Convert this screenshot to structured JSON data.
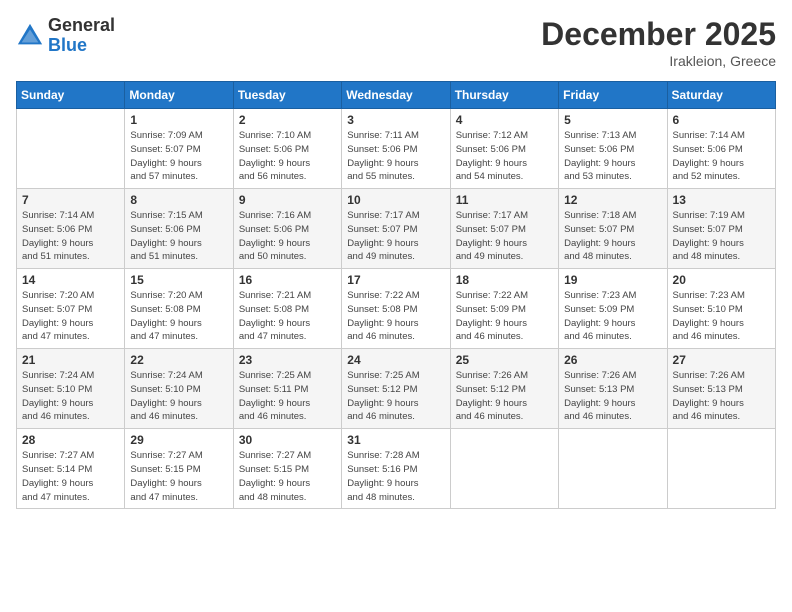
{
  "logo": {
    "general": "General",
    "blue": "Blue"
  },
  "title": "December 2025",
  "location": "Irakleion, Greece",
  "days_of_week": [
    "Sunday",
    "Monday",
    "Tuesday",
    "Wednesday",
    "Thursday",
    "Friday",
    "Saturday"
  ],
  "weeks": [
    [
      {
        "day": "",
        "info": ""
      },
      {
        "day": "1",
        "info": "Sunrise: 7:09 AM\nSunset: 5:07 PM\nDaylight: 9 hours\nand 57 minutes."
      },
      {
        "day": "2",
        "info": "Sunrise: 7:10 AM\nSunset: 5:06 PM\nDaylight: 9 hours\nand 56 minutes."
      },
      {
        "day": "3",
        "info": "Sunrise: 7:11 AM\nSunset: 5:06 PM\nDaylight: 9 hours\nand 55 minutes."
      },
      {
        "day": "4",
        "info": "Sunrise: 7:12 AM\nSunset: 5:06 PM\nDaylight: 9 hours\nand 54 minutes."
      },
      {
        "day": "5",
        "info": "Sunrise: 7:13 AM\nSunset: 5:06 PM\nDaylight: 9 hours\nand 53 minutes."
      },
      {
        "day": "6",
        "info": "Sunrise: 7:14 AM\nSunset: 5:06 PM\nDaylight: 9 hours\nand 52 minutes."
      }
    ],
    [
      {
        "day": "7",
        "info": "Sunrise: 7:14 AM\nSunset: 5:06 PM\nDaylight: 9 hours\nand 51 minutes."
      },
      {
        "day": "8",
        "info": "Sunrise: 7:15 AM\nSunset: 5:06 PM\nDaylight: 9 hours\nand 51 minutes."
      },
      {
        "day": "9",
        "info": "Sunrise: 7:16 AM\nSunset: 5:06 PM\nDaylight: 9 hours\nand 50 minutes."
      },
      {
        "day": "10",
        "info": "Sunrise: 7:17 AM\nSunset: 5:07 PM\nDaylight: 9 hours\nand 49 minutes."
      },
      {
        "day": "11",
        "info": "Sunrise: 7:17 AM\nSunset: 5:07 PM\nDaylight: 9 hours\nand 49 minutes."
      },
      {
        "day": "12",
        "info": "Sunrise: 7:18 AM\nSunset: 5:07 PM\nDaylight: 9 hours\nand 48 minutes."
      },
      {
        "day": "13",
        "info": "Sunrise: 7:19 AM\nSunset: 5:07 PM\nDaylight: 9 hours\nand 48 minutes."
      }
    ],
    [
      {
        "day": "14",
        "info": "Sunrise: 7:20 AM\nSunset: 5:07 PM\nDaylight: 9 hours\nand 47 minutes."
      },
      {
        "day": "15",
        "info": "Sunrise: 7:20 AM\nSunset: 5:08 PM\nDaylight: 9 hours\nand 47 minutes."
      },
      {
        "day": "16",
        "info": "Sunrise: 7:21 AM\nSunset: 5:08 PM\nDaylight: 9 hours\nand 47 minutes."
      },
      {
        "day": "17",
        "info": "Sunrise: 7:22 AM\nSunset: 5:08 PM\nDaylight: 9 hours\nand 46 minutes."
      },
      {
        "day": "18",
        "info": "Sunrise: 7:22 AM\nSunset: 5:09 PM\nDaylight: 9 hours\nand 46 minutes."
      },
      {
        "day": "19",
        "info": "Sunrise: 7:23 AM\nSunset: 5:09 PM\nDaylight: 9 hours\nand 46 minutes."
      },
      {
        "day": "20",
        "info": "Sunrise: 7:23 AM\nSunset: 5:10 PM\nDaylight: 9 hours\nand 46 minutes."
      }
    ],
    [
      {
        "day": "21",
        "info": "Sunrise: 7:24 AM\nSunset: 5:10 PM\nDaylight: 9 hours\nand 46 minutes."
      },
      {
        "day": "22",
        "info": "Sunrise: 7:24 AM\nSunset: 5:10 PM\nDaylight: 9 hours\nand 46 minutes."
      },
      {
        "day": "23",
        "info": "Sunrise: 7:25 AM\nSunset: 5:11 PM\nDaylight: 9 hours\nand 46 minutes."
      },
      {
        "day": "24",
        "info": "Sunrise: 7:25 AM\nSunset: 5:12 PM\nDaylight: 9 hours\nand 46 minutes."
      },
      {
        "day": "25",
        "info": "Sunrise: 7:26 AM\nSunset: 5:12 PM\nDaylight: 9 hours\nand 46 minutes."
      },
      {
        "day": "26",
        "info": "Sunrise: 7:26 AM\nSunset: 5:13 PM\nDaylight: 9 hours\nand 46 minutes."
      },
      {
        "day": "27",
        "info": "Sunrise: 7:26 AM\nSunset: 5:13 PM\nDaylight: 9 hours\nand 46 minutes."
      }
    ],
    [
      {
        "day": "28",
        "info": "Sunrise: 7:27 AM\nSunset: 5:14 PM\nDaylight: 9 hours\nand 47 minutes."
      },
      {
        "day": "29",
        "info": "Sunrise: 7:27 AM\nSunset: 5:15 PM\nDaylight: 9 hours\nand 47 minutes."
      },
      {
        "day": "30",
        "info": "Sunrise: 7:27 AM\nSunset: 5:15 PM\nDaylight: 9 hours\nand 48 minutes."
      },
      {
        "day": "31",
        "info": "Sunrise: 7:28 AM\nSunset: 5:16 PM\nDaylight: 9 hours\nand 48 minutes."
      },
      {
        "day": "",
        "info": ""
      },
      {
        "day": "",
        "info": ""
      },
      {
        "day": "",
        "info": ""
      }
    ]
  ]
}
